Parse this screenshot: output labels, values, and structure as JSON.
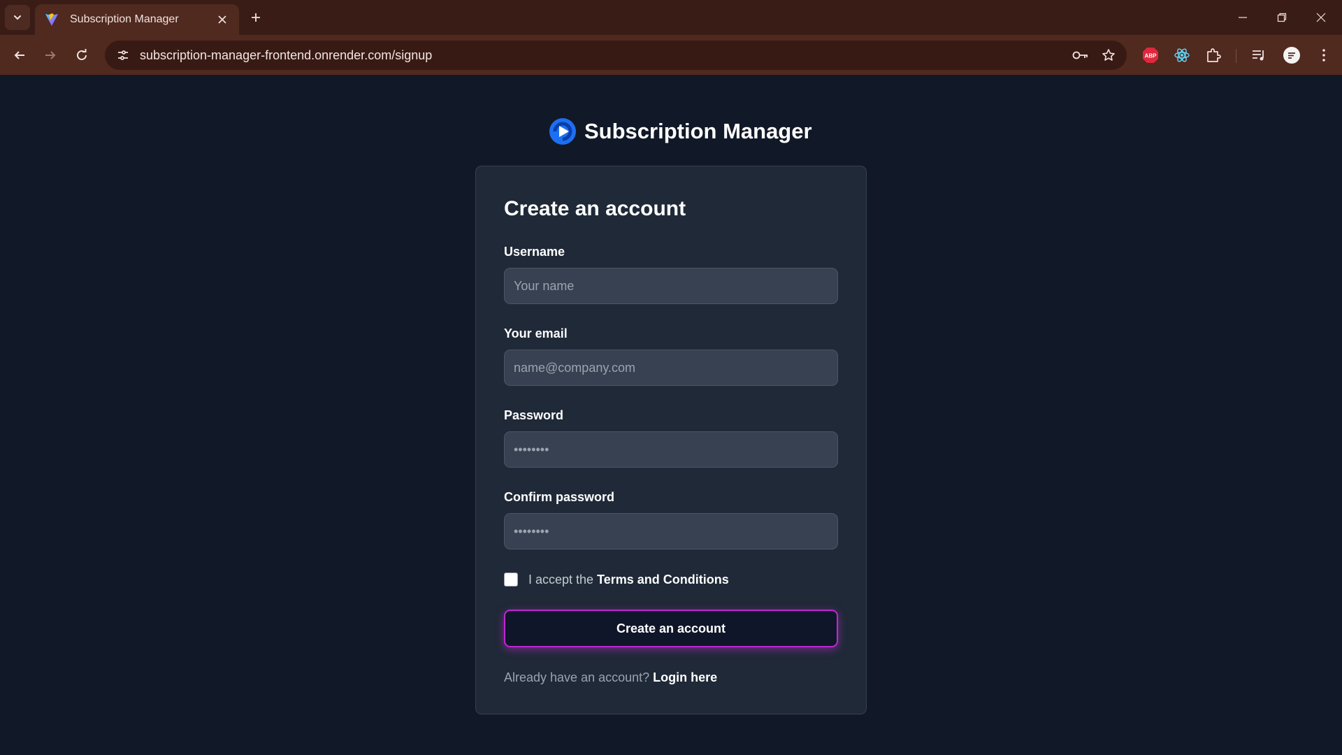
{
  "browser": {
    "tab_title": "Subscription Manager",
    "url": "subscription-manager-frontend.onrender.com/signup",
    "extensions": [
      {
        "icon": "adblock-plus-icon",
        "text": "ABP"
      },
      {
        "icon": "react-devtools-icon"
      },
      {
        "icon": "extensions-puzzle-icon"
      }
    ]
  },
  "brand": {
    "name": "Subscription Manager",
    "logo_color": "#1d6ff2"
  },
  "form": {
    "title": "Create an account",
    "fields": [
      {
        "label": "Username",
        "placeholder": "Your name",
        "value": ""
      },
      {
        "label": "Your email",
        "placeholder": "name@company.com",
        "value": ""
      },
      {
        "label": "Password",
        "placeholder": "••••••••",
        "value": ""
      },
      {
        "label": "Confirm password",
        "placeholder": "••••••••",
        "value": ""
      }
    ],
    "terms": {
      "checked": false,
      "prefix": "I accept the",
      "link": "Terms and Conditions"
    },
    "submit_label": "Create an account",
    "login_prompt": "Already have an account?",
    "login_link": "Login here"
  },
  "colors": {
    "page_bg": "#111827",
    "card_bg": "#1f2937",
    "input_bg": "#374151",
    "button_border": "#c026d3",
    "browser_frame": "#50291f"
  }
}
